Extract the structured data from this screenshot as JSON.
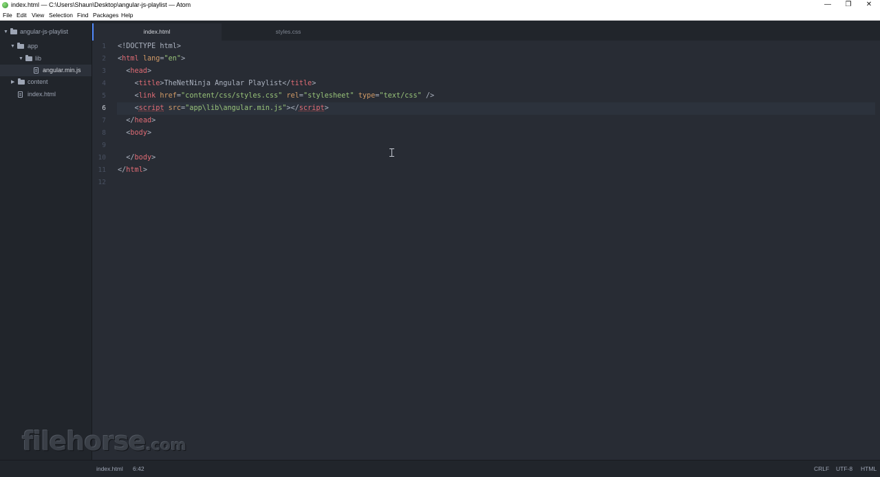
{
  "window": {
    "title": "index.html — C:\\Users\\Shaun\\Desktop\\angular-js-playlist — Atom",
    "minimize_glyph": "—",
    "maximize_glyph": "❐",
    "close_glyph": "✕"
  },
  "menu": [
    "File",
    "Edit",
    "View",
    "Selection",
    "Find",
    "Packages",
    "Help"
  ],
  "tree": {
    "project": "angular-js-playlist",
    "items": [
      {
        "label": "app",
        "type": "folder",
        "expanded": true
      },
      {
        "label": "lib",
        "type": "folder",
        "expanded": true
      },
      {
        "label": "angular.min.js",
        "type": "file",
        "selected": true
      },
      {
        "label": "content",
        "type": "folder",
        "expanded": false
      },
      {
        "label": "index.html",
        "type": "file"
      }
    ]
  },
  "tabs": [
    {
      "label": "index.html",
      "active": true
    },
    {
      "label": "styles.css",
      "active": false
    }
  ],
  "editor": {
    "line_numbers": [
      "1",
      "2",
      "3",
      "4",
      "5",
      "6",
      "7",
      "8",
      "9",
      "10",
      "11",
      "12"
    ],
    "current_line": "6",
    "lines": [
      [
        {
          "t": "<!DOCTYPE html>",
          "c": "doc"
        }
      ],
      [
        {
          "t": "<",
          "c": "punct"
        },
        {
          "t": "html",
          "c": "tag"
        },
        {
          "t": " ",
          "c": "text"
        },
        {
          "t": "lang",
          "c": "attr"
        },
        {
          "t": "=",
          "c": "punct"
        },
        {
          "t": "\"en\"",
          "c": "str"
        },
        {
          "t": ">",
          "c": "punct"
        }
      ],
      [
        {
          "t": "  <",
          "c": "punct"
        },
        {
          "t": "head",
          "c": "tag"
        },
        {
          "t": ">",
          "c": "punct"
        }
      ],
      [
        {
          "t": "    <",
          "c": "punct"
        },
        {
          "t": "title",
          "c": "tag"
        },
        {
          "t": ">",
          "c": "punct"
        },
        {
          "t": "TheNetNinja Angular Playlist",
          "c": "text"
        },
        {
          "t": "</",
          "c": "punct"
        },
        {
          "t": "title",
          "c": "tag"
        },
        {
          "t": ">",
          "c": "punct"
        }
      ],
      [
        {
          "t": "    <",
          "c": "punct"
        },
        {
          "t": "link",
          "c": "tag"
        },
        {
          "t": " ",
          "c": "text"
        },
        {
          "t": "href",
          "c": "attr"
        },
        {
          "t": "=",
          "c": "punct"
        },
        {
          "t": "\"content/css/styles.css\"",
          "c": "str"
        },
        {
          "t": " ",
          "c": "text"
        },
        {
          "t": "rel",
          "c": "attr"
        },
        {
          "t": "=",
          "c": "punct"
        },
        {
          "t": "\"stylesheet\"",
          "c": "str"
        },
        {
          "t": " ",
          "c": "text"
        },
        {
          "t": "type",
          "c": "attr"
        },
        {
          "t": "=",
          "c": "punct"
        },
        {
          "t": "\"text/css\"",
          "c": "str"
        },
        {
          "t": " />",
          "c": "punct"
        }
      ],
      [
        {
          "t": "    <",
          "c": "punct"
        },
        {
          "t": "script",
          "c": "tag",
          "u": true
        },
        {
          "t": " ",
          "c": "text"
        },
        {
          "t": "src",
          "c": "attr"
        },
        {
          "t": "=",
          "c": "punct"
        },
        {
          "t": "\"app\\lib\\angular.min.js\"",
          "c": "str"
        },
        {
          "t": "></",
          "c": "punct"
        },
        {
          "t": "script",
          "c": "tag",
          "u": true
        },
        {
          "t": ">",
          "c": "punct"
        }
      ],
      [
        {
          "t": "  </",
          "c": "punct"
        },
        {
          "t": "head",
          "c": "tag"
        },
        {
          "t": ">",
          "c": "punct"
        }
      ],
      [
        {
          "t": "  <",
          "c": "punct"
        },
        {
          "t": "body",
          "c": "tag"
        },
        {
          "t": ">",
          "c": "punct"
        }
      ],
      [],
      [
        {
          "t": "  </",
          "c": "punct"
        },
        {
          "t": "body",
          "c": "tag"
        },
        {
          "t": ">",
          "c": "punct"
        }
      ],
      [
        {
          "t": "</",
          "c": "punct"
        },
        {
          "t": "html",
          "c": "tag"
        },
        {
          "t": ">",
          "c": "punct"
        }
      ],
      []
    ]
  },
  "watermark": {
    "main": "filehorse",
    "tld": ".com"
  },
  "status": {
    "file": "index.html",
    "cursor": "6:42",
    "line_ending": "CRLF",
    "encoding": "UTF-8",
    "grammar": "HTML"
  },
  "colors": {
    "accent": "#528bff",
    "tag": "#e06c75",
    "attribute": "#d19a66",
    "string": "#98c379",
    "editor_bg": "#282c34",
    "panel_bg": "#21252b"
  }
}
